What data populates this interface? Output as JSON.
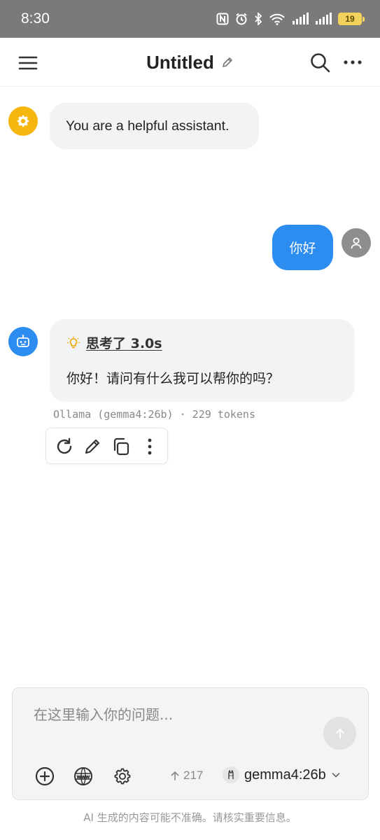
{
  "status_bar": {
    "time": "8:30",
    "battery": "19"
  },
  "header": {
    "title": "Untitled"
  },
  "messages": {
    "system": "You are a helpful assistant.",
    "user": "你好",
    "assistant": {
      "thinking_label": "思考了 3.0s",
      "text": "你好！请问有什么我可以帮你的吗？",
      "meta": "Ollama (gemma4:26b) · 229 tokens"
    }
  },
  "composer": {
    "placeholder": "在这里输入你的问题...",
    "token_count": "217",
    "model": "gemma4:26b"
  },
  "disclaimer": "AI 生成的内容可能不准确。请核实重要信息。",
  "colors": {
    "accent": "#2d8cf0",
    "system_avatar": "#f6b50f",
    "status_bar": "#7a7a7a",
    "user_avatar": "#8e8e8e"
  }
}
